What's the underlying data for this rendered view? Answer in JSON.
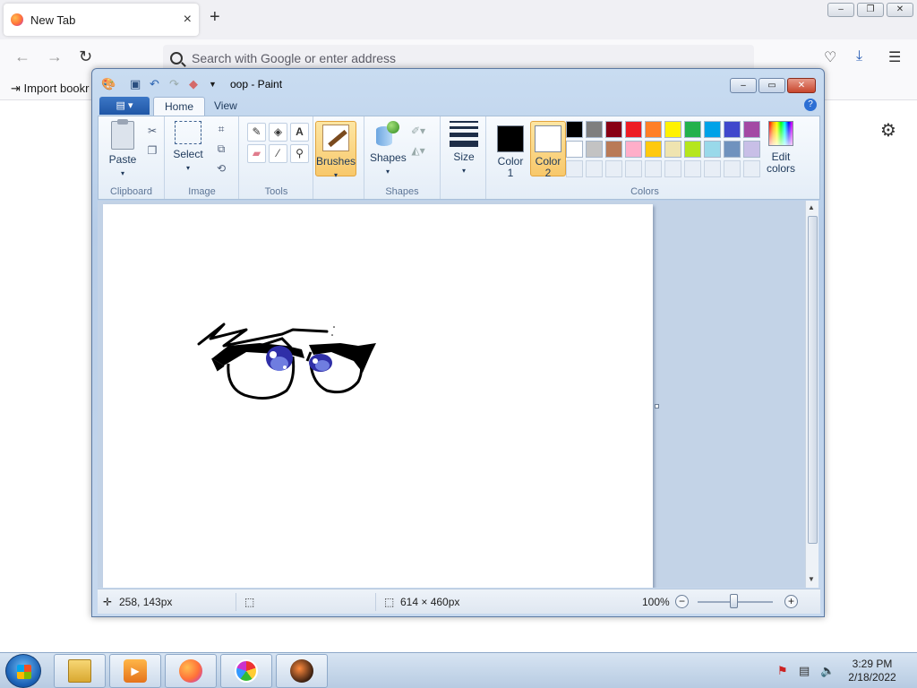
{
  "browser": {
    "tab_title": "New Tab",
    "tab_close": "×",
    "new_tab": "+",
    "url_placeholder": "Search with Google or enter address",
    "bookmarks_import": "Import bookr",
    "window_buttons": [
      "–",
      "❐",
      "✕"
    ]
  },
  "paint": {
    "window_title": "oop - Paint",
    "tabs": [
      "Home",
      "View"
    ],
    "groups": {
      "clipboard": "Clipboard",
      "image": "Image",
      "tools": "Tools",
      "shapes": "Shapes",
      "colors": "Colors"
    },
    "buttons": {
      "paste": "Paste",
      "select": "Select",
      "brushes": "Brushes",
      "shapes": "Shapes",
      "size": "Size",
      "color1_line1": "Color",
      "color1_line2": "1",
      "color2_line1": "Color",
      "color2_line2": "2",
      "edit_colors_line1": "Edit",
      "edit_colors_line2": "colors"
    },
    "active_tool": "brushes",
    "color1": "#000000",
    "color2": "#ffffff",
    "palette": [
      "#000000",
      "#7f7f7f",
      "#880015",
      "#ed1c24",
      "#ff7f27",
      "#fff200",
      "#22b14c",
      "#00a2e8",
      "#3f48cc",
      "#a349a4",
      "#ffffff",
      "#c3c3c3",
      "#b97a57",
      "#ffaec9",
      "#ffc90e",
      "#efe4b0",
      "#b5e61d",
      "#99d9ea",
      "#7092be",
      "#c8bfe7"
    ],
    "status": {
      "cursor_pos": "258, 143px",
      "image_size": "614 × 460px",
      "zoom": "100%"
    }
  },
  "taskbar": {
    "time": "3:29 PM",
    "date": "2/18/2022"
  }
}
